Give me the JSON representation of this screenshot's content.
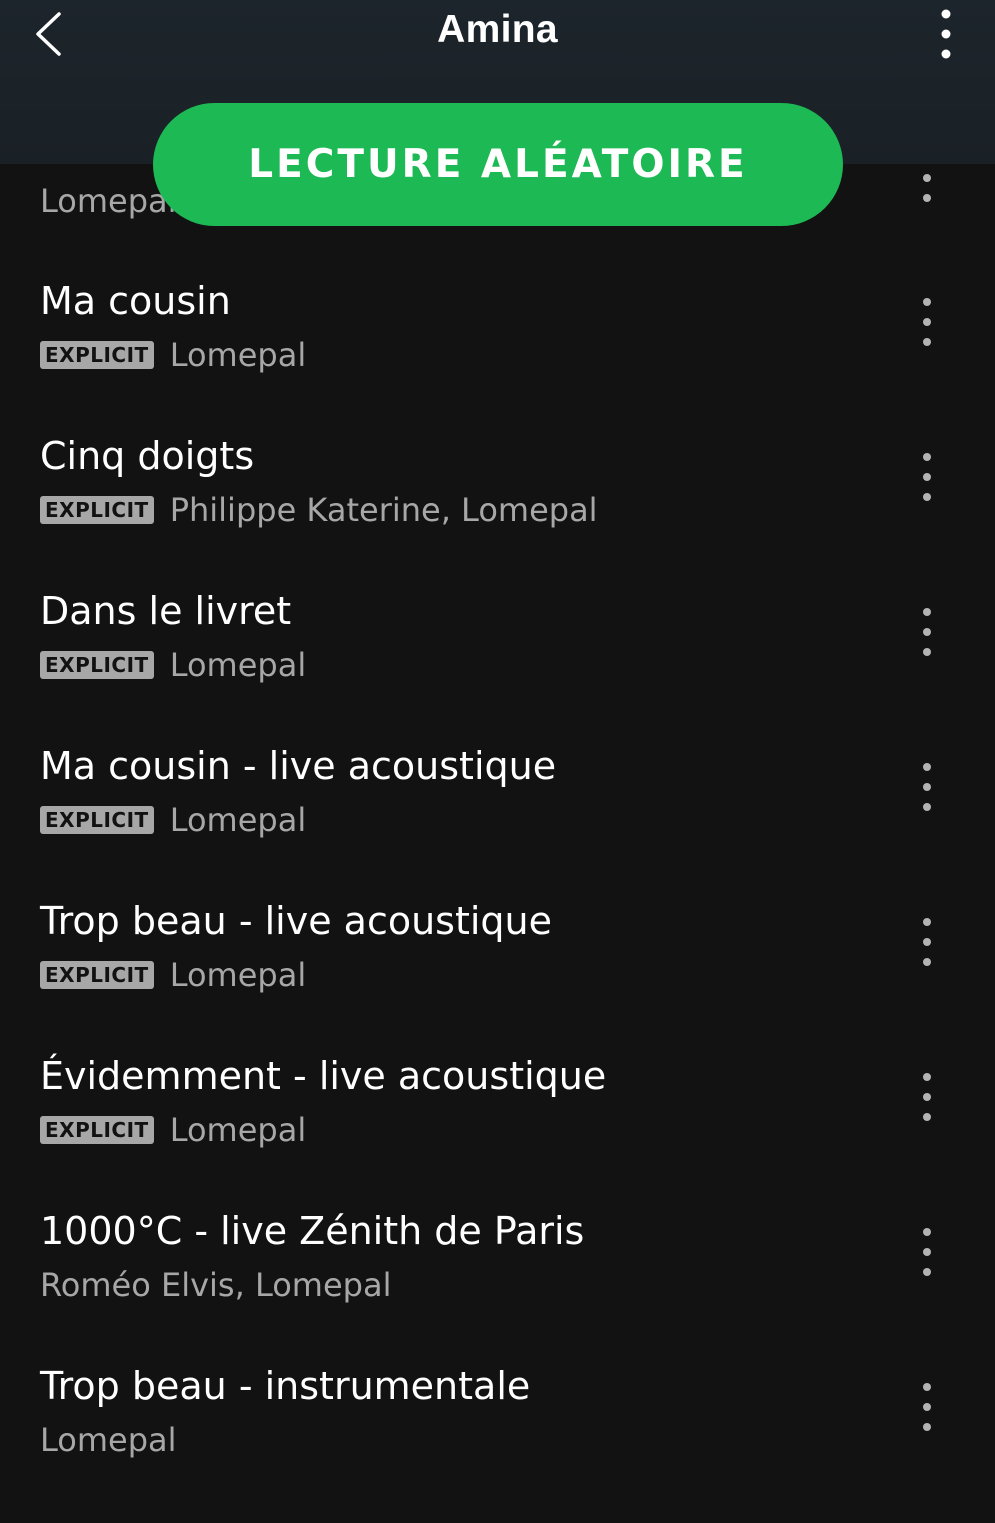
{
  "header": {
    "title": "Amina",
    "back_icon": "chevron-left-icon",
    "menu_icon": "more-vertical-icon"
  },
  "shuffle_button": {
    "label": "LECTURE ALÉATOIRE",
    "color": "#1db954"
  },
  "tracks": [
    {
      "title": "",
      "explicit": false,
      "artist": "Lomepal"
    },
    {
      "title": "Ma cousin",
      "explicit": true,
      "explicit_label": "EXPLICIT",
      "artist": "Lomepal"
    },
    {
      "title": "Cinq doigts",
      "explicit": true,
      "explicit_label": "EXPLICIT",
      "artist": "Philippe Katerine, Lomepal"
    },
    {
      "title": "Dans le livret",
      "explicit": true,
      "explicit_label": "EXPLICIT",
      "artist": "Lomepal"
    },
    {
      "title": "Ma cousin - live acoustique",
      "explicit": true,
      "explicit_label": "EXPLICIT",
      "artist": "Lomepal"
    },
    {
      "title": "Trop beau - live acoustique",
      "explicit": true,
      "explicit_label": "EXPLICIT",
      "artist": "Lomepal"
    },
    {
      "title": "Évidemment - live acoustique",
      "explicit": true,
      "explicit_label": "EXPLICIT",
      "artist": "Lomepal"
    },
    {
      "title": "1000°C - live Zénith de Paris",
      "explicit": false,
      "artist": "Roméo Elvis, Lomepal"
    },
    {
      "title": "Trop beau - instrumentale",
      "explicit": false,
      "artist": "Lomepal"
    }
  ],
  "colors": {
    "background": "#121212",
    "header": "#1c242a",
    "secondary_text": "#a7a7a7",
    "explicit_badge": "#a7a7a7"
  }
}
